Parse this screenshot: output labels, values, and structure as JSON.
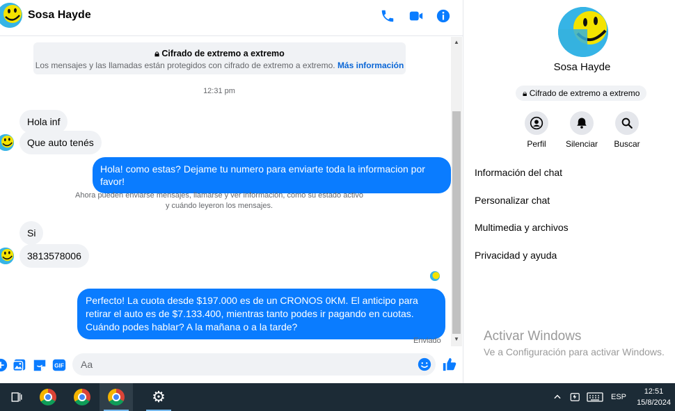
{
  "header": {
    "contact_name": "Sosa Hayde"
  },
  "conversation": {
    "e2e_title": "Cifrado de extremo a extremo",
    "e2e_body": "Los mensajes y las llamadas están protegidos con cifrado de extremo a extremo.",
    "e2e_link": "Más información",
    "time_separator": "12:31 pm",
    "messages": [
      {
        "text": "Hola inf"
      },
      {
        "text": "Que  auto  tenés"
      },
      {
        "text": "Hola! como estas? Dejame tu numero para enviarte toda la informacion por favor!"
      },
      {
        "text": "Si"
      },
      {
        "text": "3813578006"
      },
      {
        "text": "Perfecto! La cuota desde $197.000 es de un CRONOS 0KM. El anticipo para retirar el auto es de $7.133.400, mientras tanto podes ir pagando en cuotas. Cuándo podes hablar? A la mañana o a la tarde?"
      }
    ],
    "system_note_line1": "Ahora pueden enviarse mensajes, llamarse y ver información, como su estado activo",
    "system_note_line2": "y cuándo leyeron los mensajes.",
    "delivery_status": "Enviado"
  },
  "composer": {
    "placeholder": "Aa"
  },
  "details": {
    "name": "Sosa Hayde",
    "e2e_label": "Cifrado de extremo a extremo",
    "actions": [
      {
        "label": "Perfil",
        "icon": "profile-icon"
      },
      {
        "label": "Silenciar",
        "icon": "bell-icon"
      },
      {
        "label": "Buscar",
        "icon": "search-icon"
      }
    ],
    "menu": [
      {
        "label": "Información del chat"
      },
      {
        "label": "Personalizar chat"
      },
      {
        "label": "Multimedia y archivos"
      },
      {
        "label": "Privacidad y ayuda"
      }
    ],
    "watermark_title": "Activar Windows",
    "watermark_sub": "Ve a Configuración para activar Windows."
  },
  "taskbar": {
    "language": "ESP",
    "time": "12:51",
    "date": "15/8/2024"
  },
  "colors": {
    "accent": "#0a7cff",
    "bubble_in": "#f0f2f5",
    "taskbar": "#1c2b36"
  }
}
